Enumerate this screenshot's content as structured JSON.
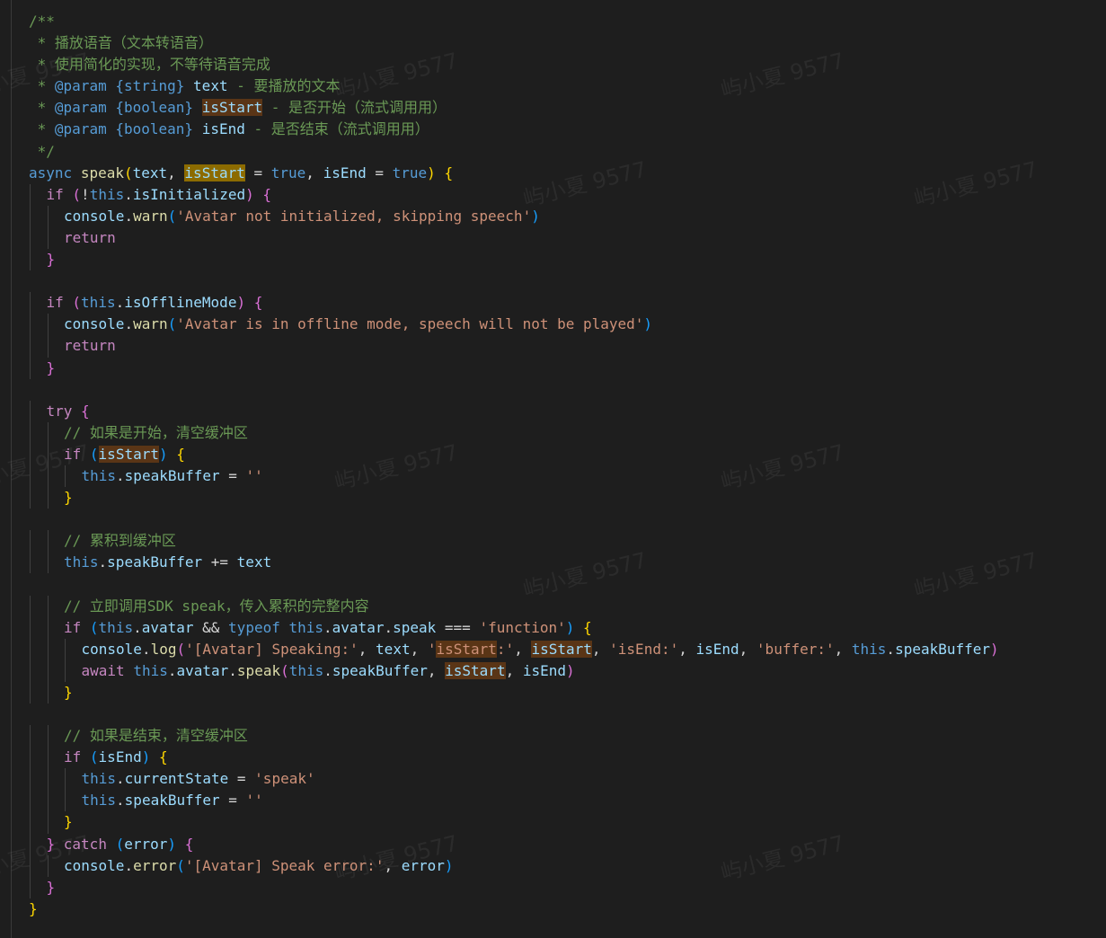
{
  "editor": {
    "background": "#1e1e1e",
    "watermark_text": "屿小夏 9577",
    "lines": [
      {
        "indent": 0,
        "tokens": [
          {
            "t": "/**",
            "c": "comment"
          }
        ]
      },
      {
        "indent": 0,
        "tokens": [
          {
            "t": " * 播放语音（文本转语音）",
            "c": "comment"
          }
        ]
      },
      {
        "indent": 0,
        "tokens": [
          {
            "t": " * 使用简化的实现，不等待语音完成",
            "c": "comment"
          }
        ]
      },
      {
        "indent": 0,
        "tokens": [
          {
            "t": " * ",
            "c": "comment"
          },
          {
            "t": "@param",
            "c": "kw"
          },
          {
            "t": " ",
            "c": "comment"
          },
          {
            "t": "{string}",
            "c": "kw"
          },
          {
            "t": " ",
            "c": "comment"
          },
          {
            "t": "text",
            "c": "var"
          },
          {
            "t": " - 要播放的文本",
            "c": "comment"
          }
        ]
      },
      {
        "indent": 0,
        "tokens": [
          {
            "t": " * ",
            "c": "comment"
          },
          {
            "t": "@param",
            "c": "kw"
          },
          {
            "t": " ",
            "c": "comment"
          },
          {
            "t": "{boolean}",
            "c": "kw"
          },
          {
            "t": " ",
            "c": "comment"
          },
          {
            "t": "isStart",
            "c": "var",
            "hl": "weak"
          },
          {
            "t": " - 是否开始（流式调用用）",
            "c": "comment"
          }
        ]
      },
      {
        "indent": 0,
        "tokens": [
          {
            "t": " * ",
            "c": "comment"
          },
          {
            "t": "@param",
            "c": "kw"
          },
          {
            "t": " ",
            "c": "comment"
          },
          {
            "t": "{boolean}",
            "c": "kw"
          },
          {
            "t": " ",
            "c": "comment"
          },
          {
            "t": "isEnd",
            "c": "var"
          },
          {
            "t": " - 是否结束（流式调用用）",
            "c": "comment"
          }
        ]
      },
      {
        "indent": 0,
        "tokens": [
          {
            "t": " */",
            "c": "comment"
          }
        ]
      },
      {
        "indent": 0,
        "tokens": [
          {
            "t": "async",
            "c": "kw"
          },
          {
            "t": " ",
            "c": "plain"
          },
          {
            "t": "speak",
            "c": "fn"
          },
          {
            "t": "(",
            "c": "b1"
          },
          {
            "t": "text",
            "c": "var"
          },
          {
            "t": ", ",
            "c": "plain"
          },
          {
            "t": "isStart",
            "c": "var",
            "hl": "strong"
          },
          {
            "t": " = ",
            "c": "plain"
          },
          {
            "t": "true",
            "c": "kw"
          },
          {
            "t": ", ",
            "c": "plain"
          },
          {
            "t": "isEnd",
            "c": "var"
          },
          {
            "t": " = ",
            "c": "plain"
          },
          {
            "t": "true",
            "c": "kw"
          },
          {
            "t": ")",
            "c": "b1"
          },
          {
            "t": " ",
            "c": "plain"
          },
          {
            "t": "{",
            "c": "b1"
          }
        ]
      },
      {
        "indent": 1,
        "tokens": [
          {
            "t": "if",
            "c": "ctrl"
          },
          {
            "t": " ",
            "c": "plain"
          },
          {
            "t": "(",
            "c": "b2"
          },
          {
            "t": "!",
            "c": "plain"
          },
          {
            "t": "this",
            "c": "kw"
          },
          {
            "t": ".",
            "c": "plain"
          },
          {
            "t": "isInitialized",
            "c": "var"
          },
          {
            "t": ")",
            "c": "b2"
          },
          {
            "t": " ",
            "c": "plain"
          },
          {
            "t": "{",
            "c": "b2"
          }
        ]
      },
      {
        "indent": 2,
        "tokens": [
          {
            "t": "console",
            "c": "var"
          },
          {
            "t": ".",
            "c": "plain"
          },
          {
            "t": "warn",
            "c": "fn"
          },
          {
            "t": "(",
            "c": "b3"
          },
          {
            "t": "'Avatar not initialized, skipping speech'",
            "c": "str"
          },
          {
            "t": ")",
            "c": "b3"
          }
        ]
      },
      {
        "indent": 2,
        "tokens": [
          {
            "t": "return",
            "c": "ctrl"
          }
        ]
      },
      {
        "indent": 1,
        "tokens": [
          {
            "t": "}",
            "c": "b2"
          }
        ]
      },
      {
        "indent": 0,
        "tokens": []
      },
      {
        "indent": 1,
        "tokens": [
          {
            "t": "if",
            "c": "ctrl"
          },
          {
            "t": " ",
            "c": "plain"
          },
          {
            "t": "(",
            "c": "b2"
          },
          {
            "t": "this",
            "c": "kw"
          },
          {
            "t": ".",
            "c": "plain"
          },
          {
            "t": "isOfflineMode",
            "c": "var"
          },
          {
            "t": ")",
            "c": "b2"
          },
          {
            "t": " ",
            "c": "plain"
          },
          {
            "t": "{",
            "c": "b2"
          }
        ]
      },
      {
        "indent": 2,
        "tokens": [
          {
            "t": "console",
            "c": "var"
          },
          {
            "t": ".",
            "c": "plain"
          },
          {
            "t": "warn",
            "c": "fn"
          },
          {
            "t": "(",
            "c": "b3"
          },
          {
            "t": "'Avatar is in offline mode, speech will not be played'",
            "c": "str"
          },
          {
            "t": ")",
            "c": "b3"
          }
        ]
      },
      {
        "indent": 2,
        "tokens": [
          {
            "t": "return",
            "c": "ctrl"
          }
        ]
      },
      {
        "indent": 1,
        "tokens": [
          {
            "t": "}",
            "c": "b2"
          }
        ]
      },
      {
        "indent": 0,
        "tokens": []
      },
      {
        "indent": 1,
        "tokens": [
          {
            "t": "try",
            "c": "ctrl"
          },
          {
            "t": " ",
            "c": "plain"
          },
          {
            "t": "{",
            "c": "b2"
          }
        ]
      },
      {
        "indent": 2,
        "tokens": [
          {
            "t": "// 如果是开始，清空缓冲区",
            "c": "comment"
          }
        ]
      },
      {
        "indent": 2,
        "tokens": [
          {
            "t": "if",
            "c": "ctrl"
          },
          {
            "t": " ",
            "c": "plain"
          },
          {
            "t": "(",
            "c": "b3"
          },
          {
            "t": "isStart",
            "c": "var",
            "hl": "weak"
          },
          {
            "t": ")",
            "c": "b3"
          },
          {
            "t": " ",
            "c": "plain"
          },
          {
            "t": "{",
            "c": "b1"
          }
        ]
      },
      {
        "indent": 3,
        "tokens": [
          {
            "t": "this",
            "c": "kw"
          },
          {
            "t": ".",
            "c": "plain"
          },
          {
            "t": "speakBuffer",
            "c": "var"
          },
          {
            "t": " = ",
            "c": "plain"
          },
          {
            "t": "''",
            "c": "str"
          }
        ]
      },
      {
        "indent": 2,
        "tokens": [
          {
            "t": "}",
            "c": "b1"
          }
        ]
      },
      {
        "indent": 0,
        "tokens": []
      },
      {
        "indent": 2,
        "tokens": [
          {
            "t": "// 累积到缓冲区",
            "c": "comment"
          }
        ]
      },
      {
        "indent": 2,
        "tokens": [
          {
            "t": "this",
            "c": "kw"
          },
          {
            "t": ".",
            "c": "plain"
          },
          {
            "t": "speakBuffer",
            "c": "var"
          },
          {
            "t": " += ",
            "c": "plain"
          },
          {
            "t": "text",
            "c": "var"
          }
        ]
      },
      {
        "indent": 0,
        "tokens": []
      },
      {
        "indent": 2,
        "tokens": [
          {
            "t": "// 立即调用SDK speak，传入累积的完整内容",
            "c": "comment"
          }
        ]
      },
      {
        "indent": 2,
        "tokens": [
          {
            "t": "if",
            "c": "ctrl"
          },
          {
            "t": " ",
            "c": "plain"
          },
          {
            "t": "(",
            "c": "b3"
          },
          {
            "t": "this",
            "c": "kw"
          },
          {
            "t": ".",
            "c": "plain"
          },
          {
            "t": "avatar",
            "c": "var"
          },
          {
            "t": " && ",
            "c": "plain"
          },
          {
            "t": "typeof",
            "c": "kw"
          },
          {
            "t": " ",
            "c": "plain"
          },
          {
            "t": "this",
            "c": "kw"
          },
          {
            "t": ".",
            "c": "plain"
          },
          {
            "t": "avatar",
            "c": "var"
          },
          {
            "t": ".",
            "c": "plain"
          },
          {
            "t": "speak",
            "c": "var"
          },
          {
            "t": " === ",
            "c": "plain"
          },
          {
            "t": "'function'",
            "c": "str"
          },
          {
            "t": ")",
            "c": "b3"
          },
          {
            "t": " ",
            "c": "plain"
          },
          {
            "t": "{",
            "c": "b1"
          }
        ]
      },
      {
        "indent": 3,
        "tokens": [
          {
            "t": "console",
            "c": "var"
          },
          {
            "t": ".",
            "c": "plain"
          },
          {
            "t": "log",
            "c": "fn"
          },
          {
            "t": "(",
            "c": "b2"
          },
          {
            "t": "'[Avatar] Speaking:'",
            "c": "str"
          },
          {
            "t": ", ",
            "c": "plain"
          },
          {
            "t": "text",
            "c": "var"
          },
          {
            "t": ", ",
            "c": "plain"
          },
          {
            "t": "'",
            "c": "str"
          },
          {
            "t": "isStart",
            "c": "str",
            "hl": "weak"
          },
          {
            "t": ":'",
            "c": "str"
          },
          {
            "t": ", ",
            "c": "plain"
          },
          {
            "t": "isStart",
            "c": "var",
            "hl": "weak"
          },
          {
            "t": ", ",
            "c": "plain"
          },
          {
            "t": "'isEnd:'",
            "c": "str"
          },
          {
            "t": ", ",
            "c": "plain"
          },
          {
            "t": "isEnd",
            "c": "var"
          },
          {
            "t": ", ",
            "c": "plain"
          },
          {
            "t": "'buffer:'",
            "c": "str"
          },
          {
            "t": ", ",
            "c": "plain"
          },
          {
            "t": "this",
            "c": "kw"
          },
          {
            "t": ".",
            "c": "plain"
          },
          {
            "t": "speakBuffer",
            "c": "var"
          },
          {
            "t": ")",
            "c": "b2"
          }
        ]
      },
      {
        "indent": 3,
        "tokens": [
          {
            "t": "await",
            "c": "ctrl"
          },
          {
            "t": " ",
            "c": "plain"
          },
          {
            "t": "this",
            "c": "kw"
          },
          {
            "t": ".",
            "c": "plain"
          },
          {
            "t": "avatar",
            "c": "var"
          },
          {
            "t": ".",
            "c": "plain"
          },
          {
            "t": "speak",
            "c": "fn"
          },
          {
            "t": "(",
            "c": "b2"
          },
          {
            "t": "this",
            "c": "kw"
          },
          {
            "t": ".",
            "c": "plain"
          },
          {
            "t": "speakBuffer",
            "c": "var"
          },
          {
            "t": ", ",
            "c": "plain"
          },
          {
            "t": "isStart",
            "c": "var",
            "hl": "weak"
          },
          {
            "t": ", ",
            "c": "plain"
          },
          {
            "t": "isEnd",
            "c": "var"
          },
          {
            "t": ")",
            "c": "b2"
          }
        ]
      },
      {
        "indent": 2,
        "tokens": [
          {
            "t": "}",
            "c": "b1"
          }
        ]
      },
      {
        "indent": 0,
        "tokens": []
      },
      {
        "indent": 2,
        "tokens": [
          {
            "t": "// 如果是结束，清空缓冲区",
            "c": "comment"
          }
        ]
      },
      {
        "indent": 2,
        "tokens": [
          {
            "t": "if",
            "c": "ctrl"
          },
          {
            "t": " ",
            "c": "plain"
          },
          {
            "t": "(",
            "c": "b3"
          },
          {
            "t": "isEnd",
            "c": "var"
          },
          {
            "t": ")",
            "c": "b3"
          },
          {
            "t": " ",
            "c": "plain"
          },
          {
            "t": "{",
            "c": "b1"
          }
        ]
      },
      {
        "indent": 3,
        "tokens": [
          {
            "t": "this",
            "c": "kw"
          },
          {
            "t": ".",
            "c": "plain"
          },
          {
            "t": "currentState",
            "c": "var"
          },
          {
            "t": " = ",
            "c": "plain"
          },
          {
            "t": "'speak'",
            "c": "str"
          }
        ]
      },
      {
        "indent": 3,
        "tokens": [
          {
            "t": "this",
            "c": "kw"
          },
          {
            "t": ".",
            "c": "plain"
          },
          {
            "t": "speakBuffer",
            "c": "var"
          },
          {
            "t": " = ",
            "c": "plain"
          },
          {
            "t": "''",
            "c": "str"
          }
        ]
      },
      {
        "indent": 2,
        "tokens": [
          {
            "t": "}",
            "c": "b1"
          }
        ]
      },
      {
        "indent": 1,
        "tokens": [
          {
            "t": "}",
            "c": "b2"
          },
          {
            "t": " ",
            "c": "plain"
          },
          {
            "t": "catch",
            "c": "ctrl"
          },
          {
            "t": " ",
            "c": "plain"
          },
          {
            "t": "(",
            "c": "b3"
          },
          {
            "t": "error",
            "c": "var"
          },
          {
            "t": ")",
            "c": "b3"
          },
          {
            "t": " ",
            "c": "plain"
          },
          {
            "t": "{",
            "c": "b2"
          }
        ]
      },
      {
        "indent": 2,
        "tokens": [
          {
            "t": "console",
            "c": "var"
          },
          {
            "t": ".",
            "c": "plain"
          },
          {
            "t": "error",
            "c": "fn"
          },
          {
            "t": "(",
            "c": "b3"
          },
          {
            "t": "'[Avatar] Speak error:'",
            "c": "str"
          },
          {
            "t": ", ",
            "c": "plain"
          },
          {
            "t": "error",
            "c": "var"
          },
          {
            "t": ")",
            "c": "b3"
          }
        ]
      },
      {
        "indent": 1,
        "tokens": [
          {
            "t": "}",
            "c": "b2"
          }
        ]
      },
      {
        "indent": 0,
        "tokens": [
          {
            "t": "}",
            "c": "b1"
          }
        ]
      }
    ]
  }
}
